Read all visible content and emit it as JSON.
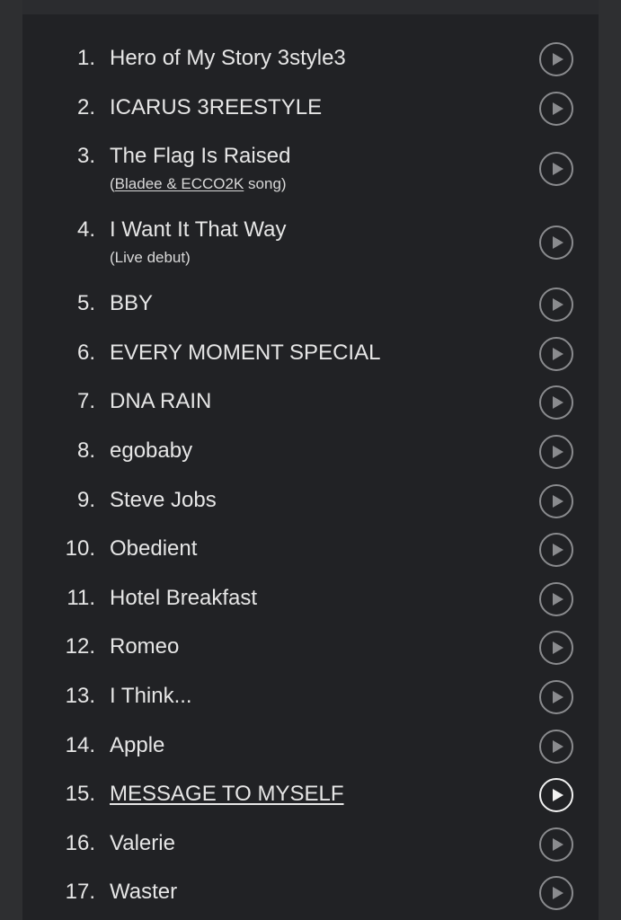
{
  "tracks": [
    {
      "number": "1.",
      "title": "Hero of My Story 3style3"
    },
    {
      "number": "2.",
      "title": "ICARUS 3REESTYLE"
    },
    {
      "number": "3.",
      "title": "The Flag Is Raised",
      "note_open": "(",
      "note_link": "Bladee & ECCO2K",
      "note_close": " song)"
    },
    {
      "number": "4.",
      "title": "I Want It That Way",
      "note": "(Live debut)"
    },
    {
      "number": "5.",
      "title": "BBY"
    },
    {
      "number": "6.",
      "title": "EVERY MOMENT SPECIAL"
    },
    {
      "number": "7.",
      "title": "DNA RAIN"
    },
    {
      "number": "8.",
      "title": "egobaby"
    },
    {
      "number": "9.",
      "title": "Steve Jobs"
    },
    {
      "number": "10.",
      "title": "Obedient"
    },
    {
      "number": "11.",
      "title": "Hotel Breakfast"
    },
    {
      "number": "12.",
      "title": "Romeo"
    },
    {
      "number": "13.",
      "title": "I Think..."
    },
    {
      "number": "14.",
      "title": "Apple"
    },
    {
      "number": "15.",
      "title": "MESSAGE TO MYSELF",
      "active": true
    },
    {
      "number": "16.",
      "title": "Valerie"
    },
    {
      "number": "17.",
      "title": "Waster"
    }
  ],
  "icons": {
    "play": "play-circle-icon"
  },
  "colors": {
    "background": "#212225",
    "text": "#e6e6e6",
    "icon": "#8a8b8e",
    "icon_active": "#f2f2f2"
  }
}
